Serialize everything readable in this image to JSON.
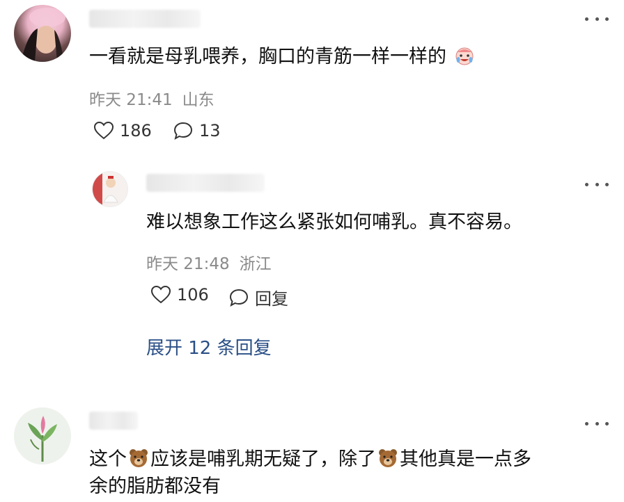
{
  "comments": [
    {
      "text": "一看就是母乳喂养，胸口的青筋一样一样的",
      "emoji": "crying-laughing-face",
      "time": "昨天 21:41",
      "location": "山东",
      "likes": "186",
      "replies": "13"
    },
    {
      "text": "难以想象工作这么紧张如何哺乳。真不容易。",
      "time": "昨天 21:48",
      "location": "浙江",
      "likes": "106",
      "reply_label": "回复",
      "expand_label": "展开 12 条回复"
    },
    {
      "text_part1": "这个",
      "text_part2": "应该是哺乳期无疑了，除了",
      "text_part3": "其他真是一点多",
      "text_line2": "余的脂肪都没有",
      "emoji": "bear-face"
    }
  ],
  "colors": {
    "link": "#2a4f86",
    "meta": "#8a8a8a"
  }
}
